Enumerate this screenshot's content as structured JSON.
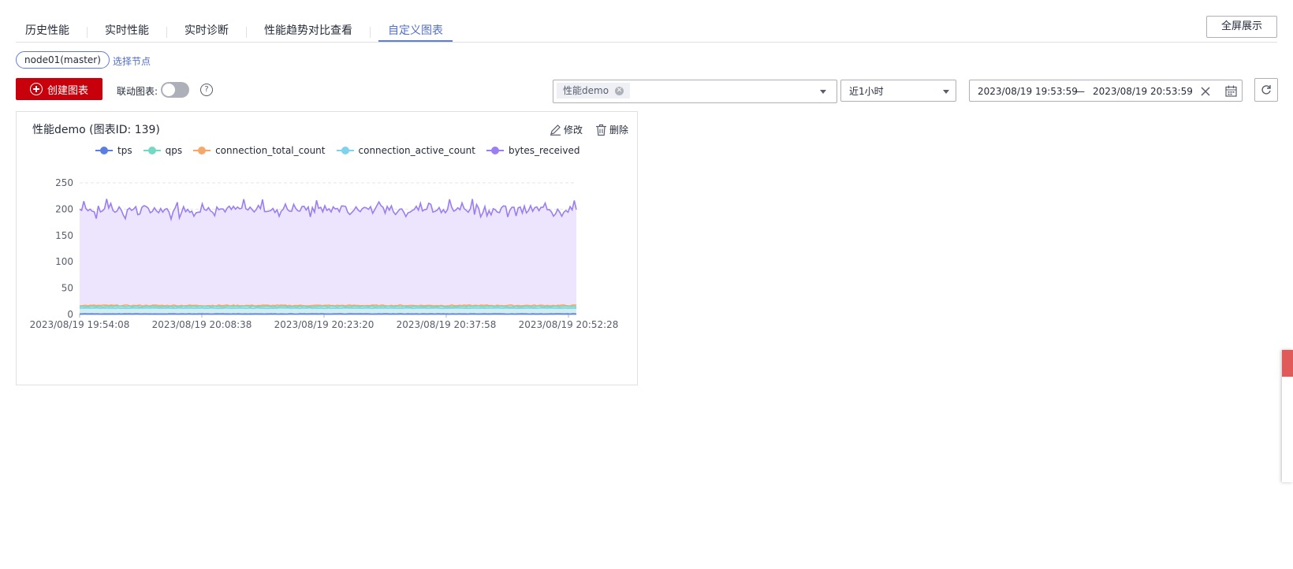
{
  "tabs": [
    {
      "label": "历史性能",
      "active": false
    },
    {
      "label": "实时性能",
      "active": false
    },
    {
      "label": "实时诊断",
      "active": false
    },
    {
      "label": "性能趋势对比查看",
      "active": false
    },
    {
      "label": "自定义图表",
      "active": true
    }
  ],
  "fullscreen_label": "全屏展示",
  "node": {
    "tag": "node01(master)",
    "select_label": "选择节点"
  },
  "toolbar": {
    "create_label": "创建图表",
    "link_label": "联动图表:",
    "link_on": false,
    "help_glyph": "?"
  },
  "chart_filter": {
    "chip": "性能demo"
  },
  "time_range": {
    "selected": "近1小时"
  },
  "date_range": {
    "start": "2023/08/19 19:53:59",
    "separator": "—",
    "end": "2023/08/19 20:53:59"
  },
  "card": {
    "title": "性能demo (图表ID: 139)",
    "edit_label": "修改",
    "delete_label": "删除"
  },
  "colors": {
    "accent": "#5e7ce0",
    "danger": "#c7000b",
    "tps": "#5b7fe0",
    "qps": "#74d8c2",
    "connection_total_count": "#f5a868",
    "connection_active_count": "#7fd2ea",
    "bytes_received": "#9b7ef0"
  },
  "chart_data": {
    "type": "area",
    "title": "",
    "xlabel": "",
    "ylabel": "",
    "ylim": [
      0,
      250
    ],
    "yticks": [
      "250",
      "200",
      "150",
      "100",
      "50",
      "0"
    ],
    "x_tick_labels": [
      "2023/08/19 19:54:08",
      "2023/08/19 20:08:38",
      "2023/08/19 20:23:20",
      "2023/08/19 20:37:58",
      "2023/08/19 20:52:28"
    ],
    "grid": true,
    "legend_position": "top",
    "series": [
      {
        "name": "tps",
        "approx_value": 1
      },
      {
        "name": "qps",
        "approx_value": 15
      },
      {
        "name": "connection_total_count",
        "approx_value": 17
      },
      {
        "name": "connection_active_count",
        "approx_value": 12
      },
      {
        "name": "bytes_received",
        "approx_value": 200,
        "range": [
          180,
          220
        ]
      }
    ]
  }
}
